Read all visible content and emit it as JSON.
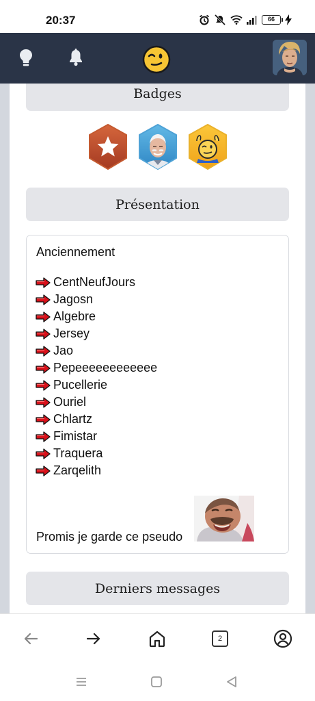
{
  "status_bar": {
    "time": "20:37",
    "battery": "66",
    "icons": [
      "alarm-icon",
      "mute-icon",
      "wifi-icon",
      "signal-icon",
      "battery-icon",
      "charging-icon"
    ]
  },
  "header": {
    "icons": [
      "lightbulb-icon",
      "bell-icon",
      "smiley-logo-icon",
      "profile-avatar"
    ],
    "header_color": "#2a3447"
  },
  "sections": {
    "badges": "Badges",
    "presentation": "Présentation",
    "messages": "Derniers messages"
  },
  "badges": [
    "star-badge",
    "harold-badge",
    "smiley-wave-badge"
  ],
  "presentation": {
    "title": "Anciennement",
    "names": [
      "CentNeufJours",
      "Jagosn",
      "Algebre",
      "Jersey",
      "Jao",
      "Pepeeeeeeeeeeee",
      "Pucellerie",
      "Ouriel",
      "Chlartz",
      "Fimistar",
      "Traquera",
      "Zarqelith"
    ],
    "footer": "Promis je garde ce pseudo"
  },
  "browser_bar": {
    "tab_count": "2",
    "icons": [
      "back-arrow-icon",
      "forward-arrow-icon",
      "home-icon",
      "tabs-icon",
      "account-icon"
    ]
  },
  "android_nav": {
    "icons": [
      "recents-icon",
      "home-square-icon",
      "back-triangle-icon"
    ]
  },
  "colors": {
    "accent_red": "#d8111a",
    "section_bg": "#e4e5e9",
    "page_bg": "#d3d7de"
  }
}
